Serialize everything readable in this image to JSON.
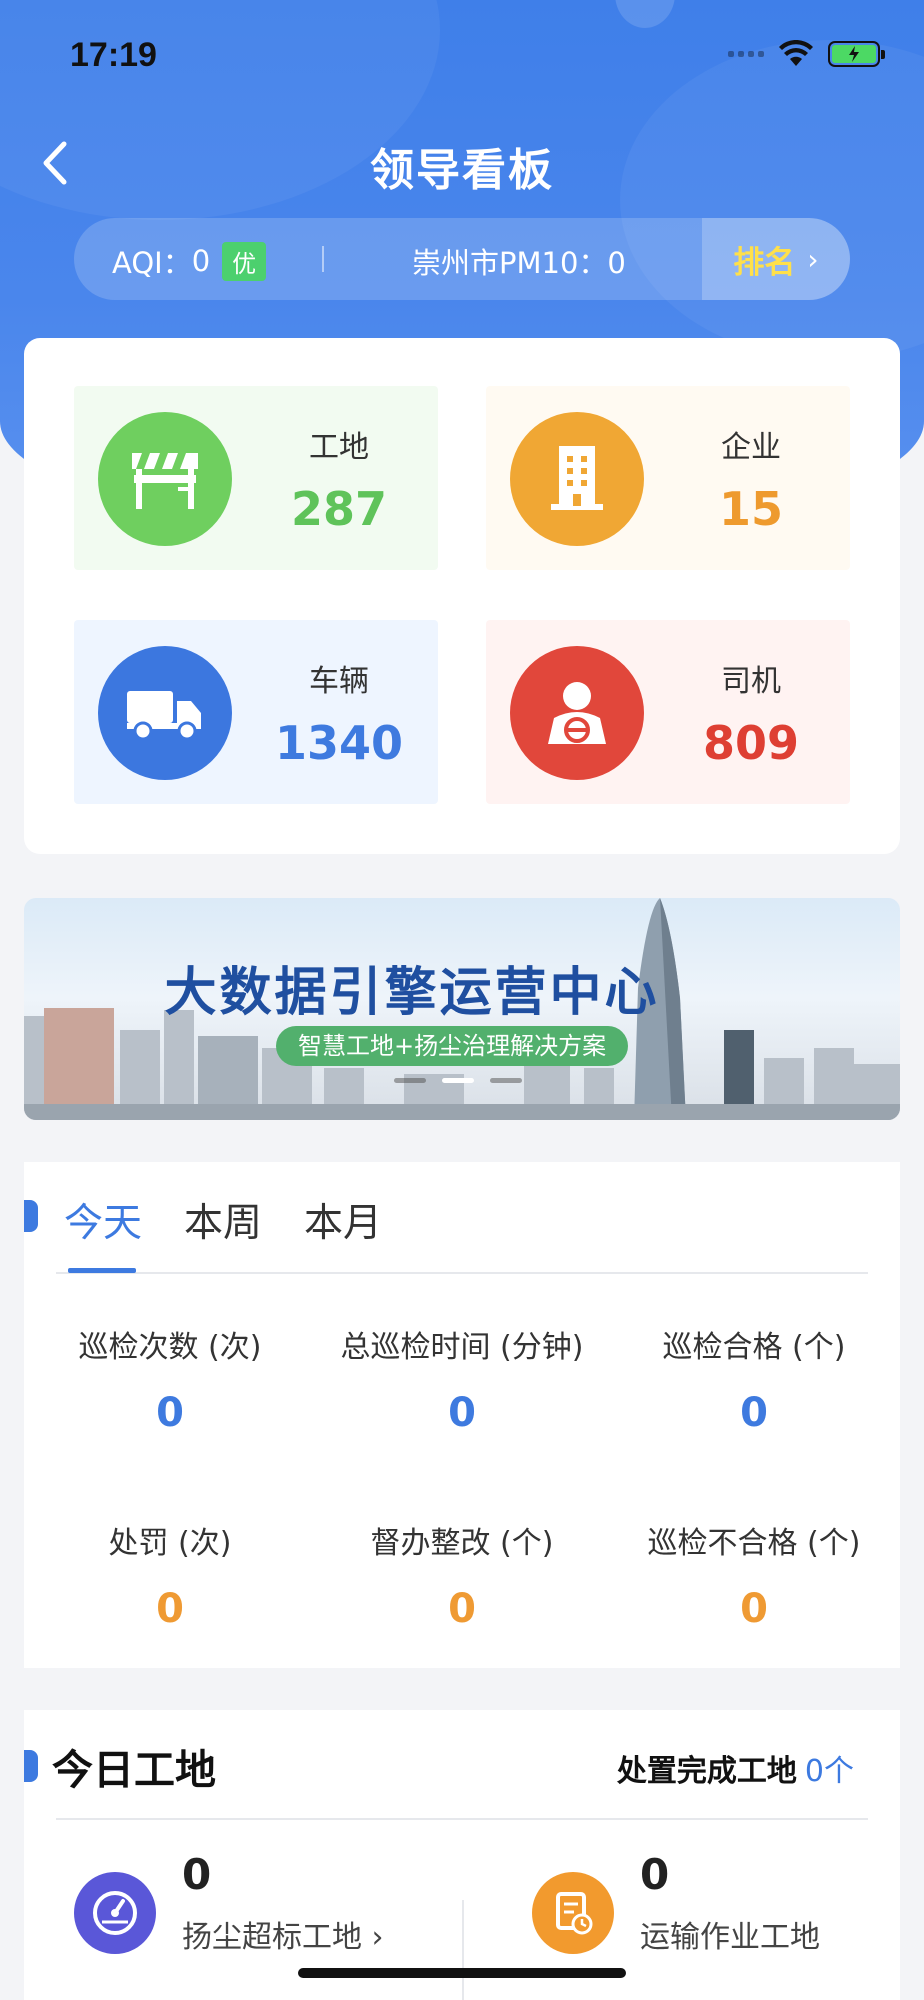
{
  "status_bar": {
    "time": "17:19"
  },
  "header": {
    "title": "领导看板"
  },
  "aqi": {
    "label": "AQI：",
    "value": "0",
    "level": "优",
    "pm10_label": "崇州市PM10：",
    "pm10_value": "0",
    "rank_label": "排名"
  },
  "stats": [
    {
      "label": "工地",
      "value": "287",
      "icon": "construction-site-icon",
      "color": "#6fcf5f"
    },
    {
      "label": "企业",
      "value": "15",
      "icon": "building-icon",
      "color": "#f0a734"
    },
    {
      "label": "车辆",
      "value": "1340",
      "icon": "truck-icon",
      "color": "#3c77df"
    },
    {
      "label": "司机",
      "value": "809",
      "icon": "driver-icon",
      "color": "#e1473b"
    }
  ],
  "banner": {
    "title": "大数据引擎运营中心",
    "subtitle": "智慧工地+扬尘治理解决方案",
    "slide_count": 3,
    "active_slide": 2
  },
  "period": {
    "tabs": [
      "今天",
      "本周",
      "本月"
    ],
    "active_tab": 0,
    "metrics": [
      {
        "label": "巡检次数 (次)",
        "value": "0"
      },
      {
        "label": "总巡检时间 (分钟)",
        "value": "0"
      },
      {
        "label": "巡检合格 (个)",
        "value": "0"
      },
      {
        "label": "处罚 (次)",
        "value": "0"
      },
      {
        "label": "督办整改 (个)",
        "value": "0"
      },
      {
        "label": "巡检不合格 (个)",
        "value": "0"
      }
    ]
  },
  "today": {
    "title": "今日工地",
    "completed_label": "处置完成工地",
    "completed_value": "0个",
    "items": [
      {
        "value": "0",
        "label": "扬尘超标工地 ›",
        "icon": "gauge-icon",
        "color": "#5a57d8"
      },
      {
        "value": "0",
        "label": "运输作业工地",
        "icon": "transport-doc-icon",
        "color": "#f29a2e"
      }
    ]
  },
  "colors": {
    "accent": "#3d7ae0",
    "good": "#4cd06e",
    "rank": "#ffe04a"
  }
}
